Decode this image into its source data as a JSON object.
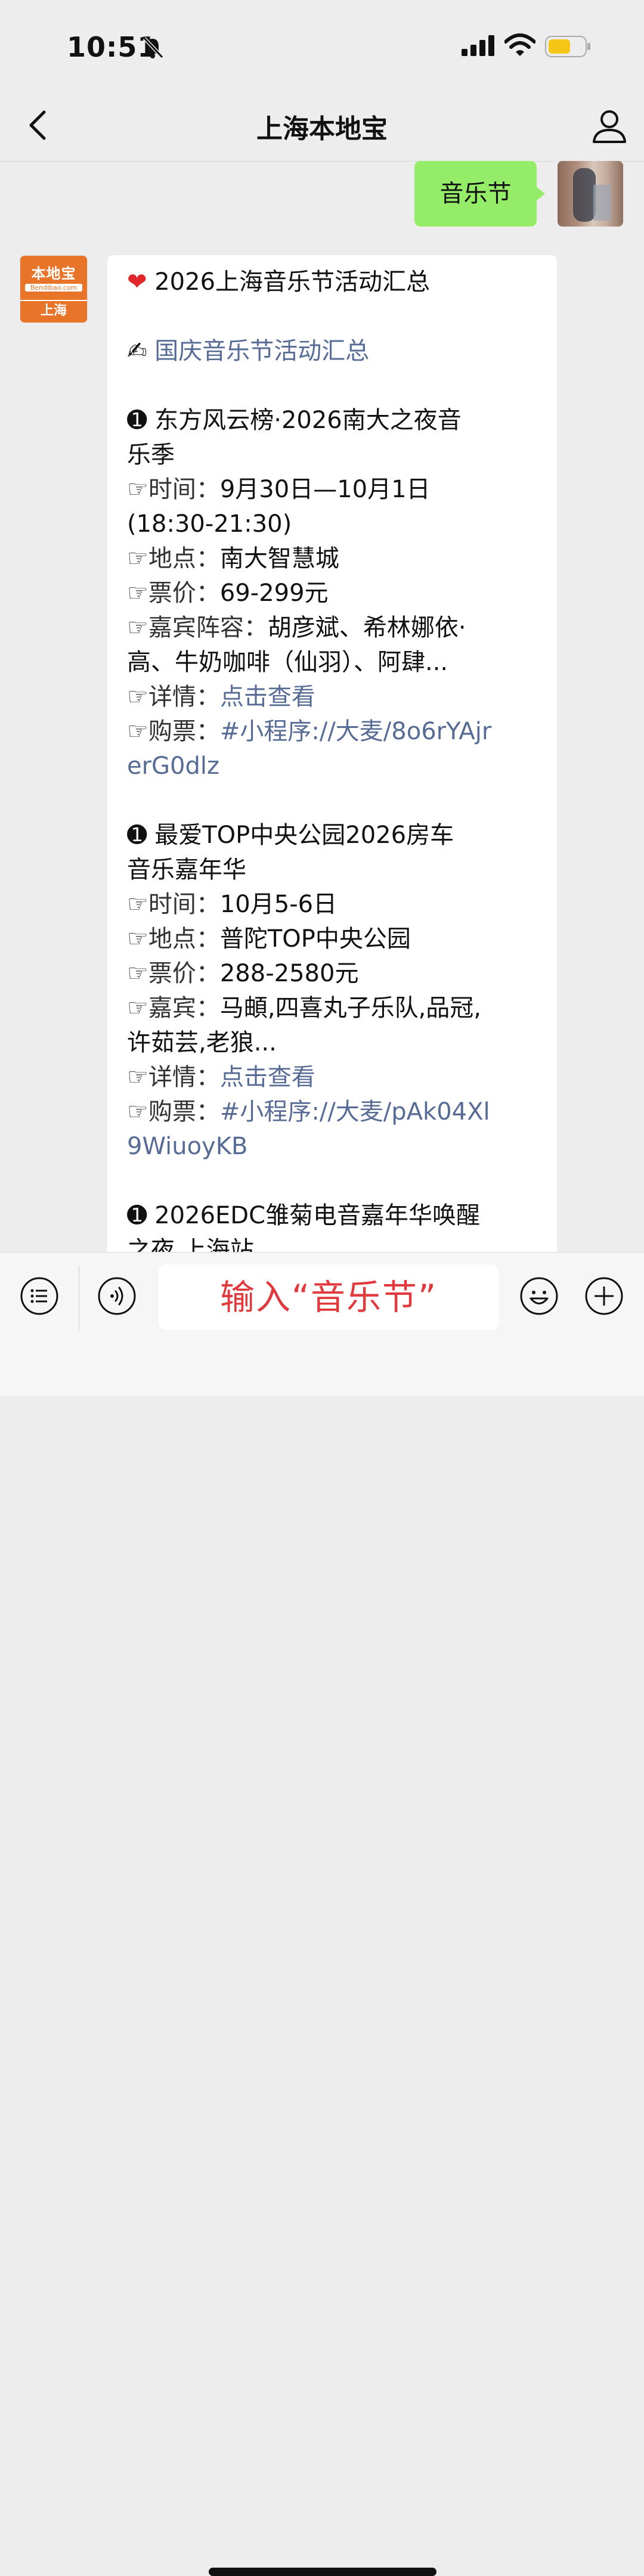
{
  "status_bar": {
    "time": "10:51"
  },
  "nav": {
    "title": "上海本地宝"
  },
  "outgoing_message": "音乐节",
  "bot": {
    "logo_name": "本地宝",
    "logo_site": "Bendibao.com",
    "logo_city": "上海"
  },
  "message": {
    "heading": "2026上海音乐节活动汇总",
    "link_line": "国庆音乐节活动汇总",
    "events": [
      {
        "title_line1": "➊ 东方风云榜·2026南大之夜音",
        "title_line2": "乐季",
        "time_label": "☞时间：",
        "time_value": "9月30日—10月1日",
        "time_extra": "(18:30-21:30)",
        "place_label": "☞地点：",
        "place_value": "南大智慧城",
        "price_label": "☞票价：",
        "price_value": "69-299元",
        "guests_label": "☞嘉宾阵容：",
        "guests_value": "胡彦斌、希林娜依·",
        "guests_line2": "高、牛奶咖啡（仙羽）、阿肆...",
        "detail_label": "☞详情：",
        "detail_link": "点击查看",
        "ticket_label": "☞购票：",
        "ticket_link1": "#小程序://大麦/8o6rYAjr",
        "ticket_link2": "erG0dlz"
      },
      {
        "title_line1": "➊ 最爱TOP中央公园2026房车",
        "title_line2": "音乐嘉年华",
        "time_label": "☞时间：",
        "time_value": "10月5-6日",
        "place_label": "☞地点：",
        "place_value": "普陀TOP中央公园",
        "price_label": "☞票价：",
        "price_value": "288-2580元",
        "guests_label": "☞嘉宾：",
        "guests_value": "马頔,四喜丸子乐队,品冠,",
        "guests_line2": "许茹芸,老狼...",
        "detail_label": "☞详情：",
        "detail_link": "点击查看",
        "ticket_label": "☞购票：",
        "ticket_link1": "#小程序://大麦/pAk04Xl",
        "ticket_link2": "9WiuoyKB"
      },
      {
        "title_line1": "➊ 2026EDC雏菊电音嘉年华唤醒",
        "title_line2": "之夜 上海站"
      }
    ]
  },
  "input": {
    "placeholder": "输入“音乐节”"
  }
}
